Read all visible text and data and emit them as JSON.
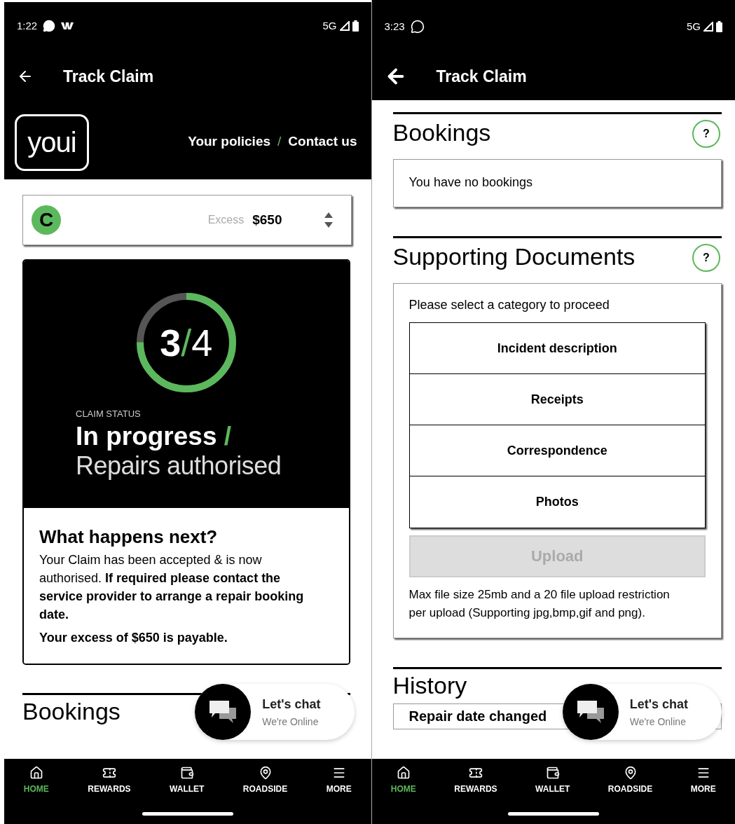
{
  "phones": [
    {
      "status_bar": {
        "time": "1:22",
        "notifications": [
          {
            "kind": "messenger"
          },
          {
            "kind": "w-mark"
          }
        ],
        "network": "5G"
      },
      "app_bar": {
        "title": "Track Claim"
      },
      "content": [
        {
          "kind": "brand_header",
          "logo": "youi",
          "links": [
            "Your policies",
            "Contact us"
          ],
          "separator": "/"
        },
        {
          "kind": "policy_selector",
          "avatar": "C",
          "excess_label": "Excess",
          "excess_value": "$650"
        },
        {
          "kind": "claim_status",
          "step": "3",
          "step_separator": "/",
          "total": "4",
          "level": 0.75,
          "label": "CLAIM STATUS",
          "status": "In progress",
          "status_separator": "/",
          "substatus": "Repairs authorised",
          "next_title": "What happens next?",
          "next_body": "Your Claim has been accepted & is now authorised. **If required please contact the service provider to arrange a repair booking date.**",
          "next_note": "Your excess of $650 is payable."
        },
        {
          "kind": "section",
          "title": "Bookings"
        }
      ],
      "chat": {
        "title": "Let's chat",
        "subtitle": "We're Online"
      },
      "nav": [
        {
          "kind": "home",
          "label": "HOME",
          "selected": true
        },
        {
          "kind": "rewards",
          "label": "REWARDS",
          "selected": false
        },
        {
          "kind": "wallet",
          "label": "WALLET",
          "selected": false
        },
        {
          "kind": "roadside",
          "label": "ROADSIDE",
          "selected": false
        },
        {
          "kind": "more",
          "label": "MORE",
          "selected": false
        }
      ]
    },
    {
      "status_bar": {
        "time": "3:23",
        "notifications": [
          {
            "kind": "whatsapp"
          }
        ],
        "network": "5G"
      },
      "app_bar": {
        "title": "Track Claim"
      },
      "content": [
        {
          "kind": "section",
          "title": "Bookings",
          "help": "?",
          "empty_text": "You have no bookings"
        },
        {
          "kind": "section",
          "title": "Supporting Documents",
          "help": "?",
          "prompt": "Please select a category to proceed",
          "categories": [
            "Incident description",
            "Receipts",
            "Correspondence",
            "Photos"
          ],
          "upload": {
            "label": "Upload",
            "disabled": true
          },
          "note": "Max file size 25mb and a 20 file upload restriction per upload (Supporting jpg,bmp,gif and png)."
        },
        {
          "kind": "section",
          "title": "History",
          "history": [
            {
              "title": "Repair date changed"
            }
          ]
        }
      ],
      "chat": {
        "title": "Let's chat",
        "subtitle": "We're Online"
      },
      "nav": [
        {
          "kind": "home",
          "label": "HOME",
          "selected": true
        },
        {
          "kind": "rewards",
          "label": "REWARDS",
          "selected": false
        },
        {
          "kind": "wallet",
          "label": "WALLET",
          "selected": false
        },
        {
          "kind": "roadside",
          "label": "ROADSIDE",
          "selected": false
        },
        {
          "kind": "more",
          "label": "MORE",
          "selected": false
        }
      ]
    }
  ]
}
